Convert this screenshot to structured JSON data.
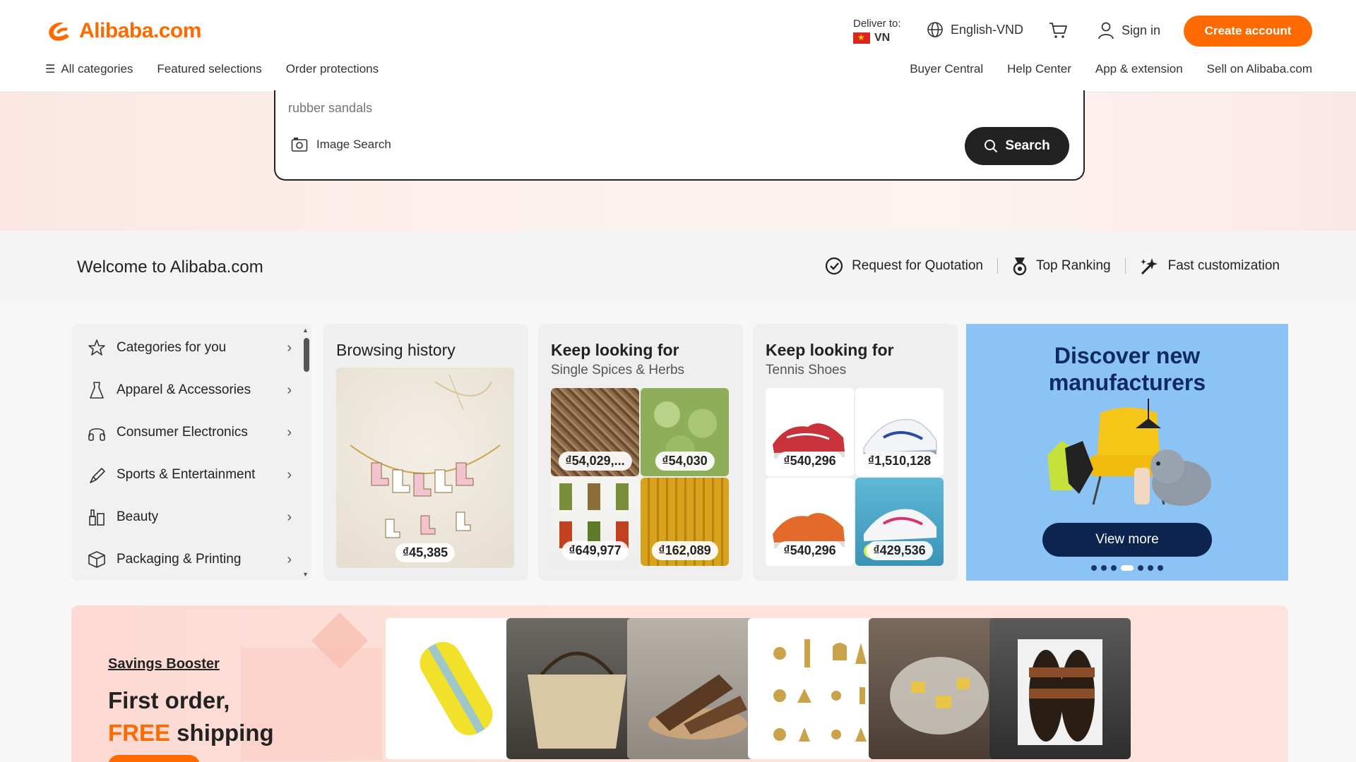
{
  "header": {
    "logo_text": "Alibaba.com",
    "deliver_label": "Deliver to:",
    "deliver_country": "VN",
    "language": "English-VND",
    "sign_in": "Sign in",
    "create_account": "Create account"
  },
  "nav": {
    "left": [
      "All categories",
      "Featured selections",
      "Order protections"
    ],
    "right": [
      "Buyer Central",
      "Help Center",
      "App & extension",
      "Sell on Alibaba.com"
    ]
  },
  "search": {
    "placeholder": "rubber sandals",
    "image_search": "Image Search",
    "button": "Search"
  },
  "welcome": {
    "title": "Welcome to Alibaba.com",
    "links": [
      "Request for Quotation",
      "Top Ranking",
      "Fast customization"
    ]
  },
  "categories": [
    {
      "label": "Categories for you",
      "icon": "star-icon"
    },
    {
      "label": "Apparel & Accessories",
      "icon": "dress-icon"
    },
    {
      "label": "Consumer Electronics",
      "icon": "headphones-icon"
    },
    {
      "label": "Sports & Entertainment",
      "icon": "sports-icon"
    },
    {
      "label": "Beauty",
      "icon": "beauty-icon"
    },
    {
      "label": "Packaging & Printing",
      "icon": "box-icon"
    }
  ],
  "browsing_history": {
    "title": "Browsing history",
    "price": "₫45,385"
  },
  "keep_looking_1": {
    "title": "Keep looking for",
    "subtitle": "Single Spices & Herbs",
    "prices": [
      "₫54,029,...",
      "₫54,030",
      "₫649,977",
      "₫162,089"
    ]
  },
  "keep_looking_2": {
    "title": "Keep looking for",
    "subtitle": "Tennis Shoes",
    "prices": [
      "₫540,296",
      "₫1,510,128",
      "₫540,296",
      "₫429,536"
    ]
  },
  "promo": {
    "title_line1": "Discover new",
    "title_line2": "manufacturers",
    "button": "View more"
  },
  "savings": {
    "label": "Savings Booster",
    "title_line1": "First order,",
    "title_free": "FREE",
    "title_rest": " shipping"
  },
  "colors": {
    "brand": "#ff6a00",
    "dark": "#222222",
    "promo_bg": "#8cc3f5",
    "navy": "#0d2451"
  }
}
